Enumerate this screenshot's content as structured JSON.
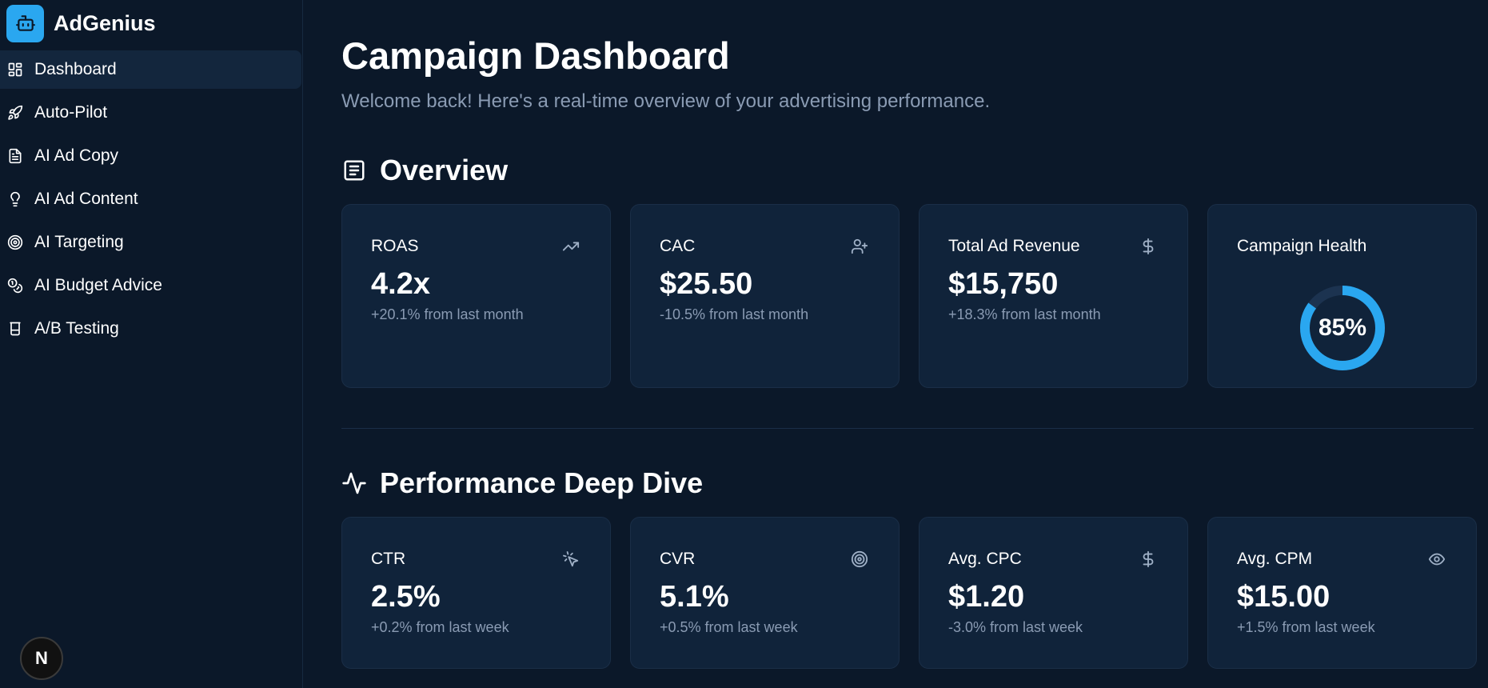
{
  "brand": {
    "name": "AdGenius",
    "icon": "robot-icon"
  },
  "sidebar": {
    "items": [
      {
        "label": "Dashboard",
        "icon": "dashboard-icon",
        "active": true
      },
      {
        "label": "Auto-Pilot",
        "icon": "rocket-icon"
      },
      {
        "label": "AI Ad Copy",
        "icon": "document-icon"
      },
      {
        "label": "AI Ad Content",
        "icon": "lightbulb-icon"
      },
      {
        "label": "AI Targeting",
        "icon": "target-icon"
      },
      {
        "label": "AI Budget Advice",
        "icon": "coins-icon"
      },
      {
        "label": "A/B Testing",
        "icon": "beaker-icon"
      }
    ]
  },
  "header": {
    "title": "Campaign Dashboard",
    "subtitle": "Welcome back! Here's a real-time overview of your advertising performance."
  },
  "overview": {
    "title": "Overview",
    "cards": [
      {
        "label": "ROAS",
        "value": "4.2x",
        "change": "+20.1% from last month",
        "icon": "trending-up-icon"
      },
      {
        "label": "CAC",
        "value": "$25.50",
        "change": "-10.5% from last month",
        "icon": "user-plus-icon"
      },
      {
        "label": "Total Ad Revenue",
        "value": "$15,750",
        "change": "+18.3% from last month",
        "icon": "dollar-icon"
      },
      {
        "label": "Campaign Health",
        "value": "85%",
        "percent": 85
      }
    ]
  },
  "deep_dive": {
    "title": "Performance Deep Dive",
    "cards": [
      {
        "label": "CTR",
        "value": "2.5%",
        "change": "+0.2% from last week",
        "icon": "cursor-click-icon"
      },
      {
        "label": "CVR",
        "value": "5.1%",
        "change": "+0.5% from last week",
        "icon": "target-icon"
      },
      {
        "label": "Avg. CPC",
        "value": "$1.20",
        "change": "-3.0% from last week",
        "icon": "dollar-icon"
      },
      {
        "label": "Avg. CPM",
        "value": "$15.00",
        "change": "+1.5% from last week",
        "icon": "eye-icon"
      }
    ]
  },
  "footer_badge": {
    "label": "N"
  },
  "colors": {
    "background": "#0b1829",
    "card": "#10233a",
    "accent": "#2aa7f0",
    "muted": "#8a9bb3"
  }
}
